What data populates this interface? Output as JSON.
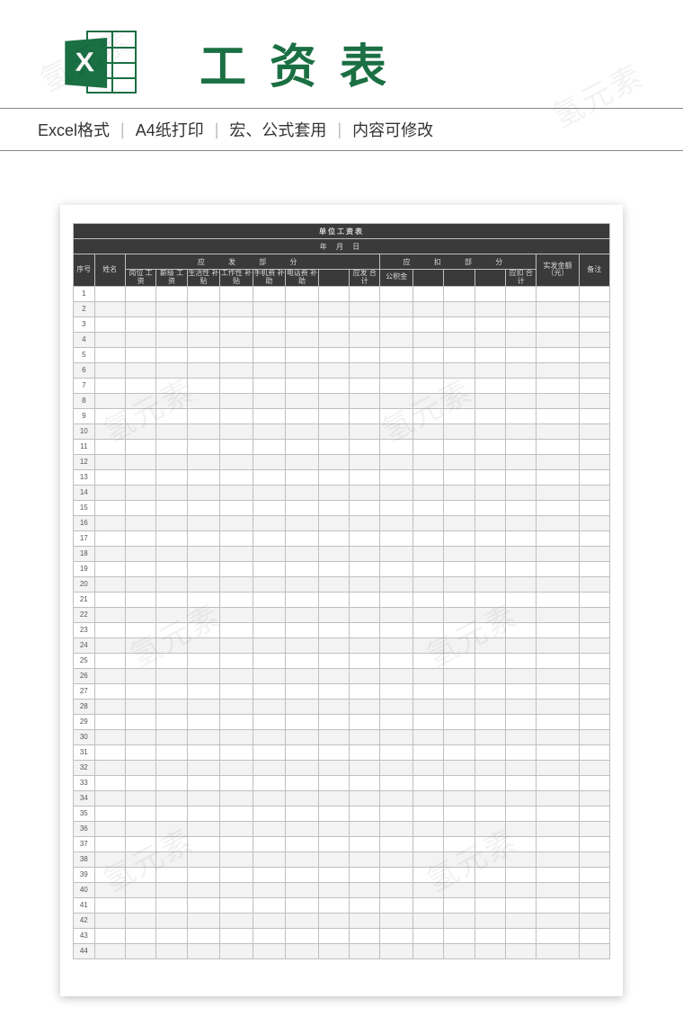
{
  "header": {
    "icon_letter": "X",
    "page_title": "工资表"
  },
  "features": {
    "f1": "Excel格式",
    "f2": "A4纸打印",
    "f3": "宏、公式套用",
    "f4": "内容可修改"
  },
  "sheet": {
    "title": "单位工资表",
    "date_label": "年  月  日",
    "group_pay": "应  发  部  分",
    "group_deduct": "应  扣  部  分",
    "cols": {
      "seq": "序号",
      "name": "姓名",
      "base_pay": "岗位\n工资",
      "level_pay": "薪级\n工资",
      "life_sub": "生活性\n补贴",
      "work_sub": "工作性\n补贴",
      "phone_sub": "手机费\n补助",
      "tel_sub": "电话费\n补助",
      "pay_blank": "",
      "pay_total": "应发\n合计",
      "fund": "公积金",
      "ded_b1": "",
      "ded_b2": "",
      "ded_b3": "",
      "ded_total": "应扣\n合计",
      "net": "实发金额\n（元）",
      "note": "备注"
    },
    "row_count": 44
  },
  "watermark": "氢元素"
}
